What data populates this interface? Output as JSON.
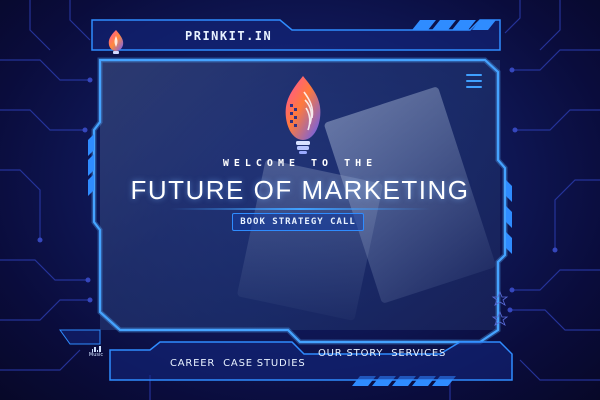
{
  "brand": {
    "name": "PRINKIT.IN"
  },
  "hero": {
    "welcome": "WELCOME TO THE",
    "headline": "FUTURE OF MARKETING",
    "cta_label": "BOOK STRATEGY CALL"
  },
  "nav": {
    "left_items": [
      "CAREER",
      "CASE STUDIES"
    ],
    "right_items": [
      "OUR STORY",
      "SERVICES"
    ]
  },
  "music": {
    "label": "Music"
  },
  "icons": {
    "brand_logo": "flame-bulb-logo",
    "menu": "hamburger-menu-icon",
    "music": "equalizer-icon"
  },
  "colors": {
    "accent": "#3fa0ff",
    "frame": "#2f8cff",
    "background": "#0a0c3c",
    "text": "#e8f2ff"
  }
}
